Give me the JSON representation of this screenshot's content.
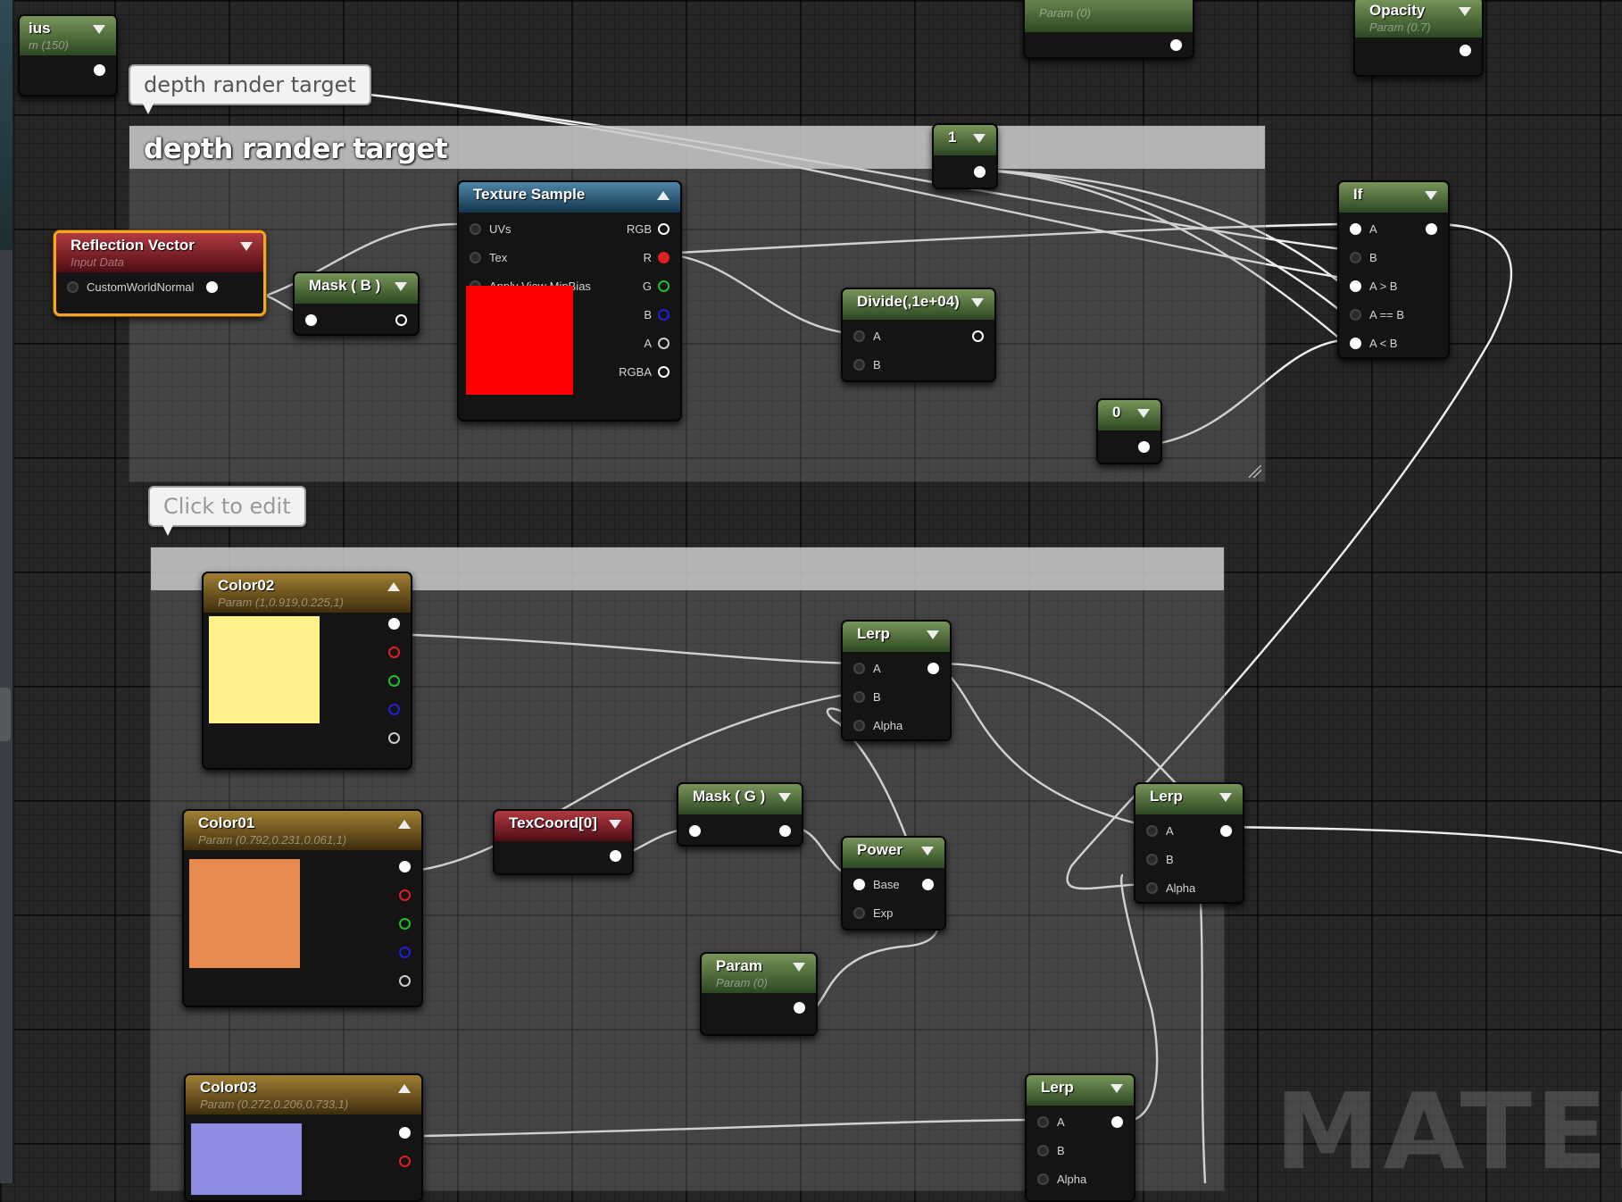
{
  "comments": {
    "top": {
      "bubble": "depth rander target",
      "title": "depth rander target"
    },
    "bottom": {
      "bubble": "Click to edit",
      "title": ""
    }
  },
  "nodes": {
    "radius": {
      "title": "ius",
      "subtitle": "m (150)"
    },
    "param_top": {
      "subtitle": "Param (0)"
    },
    "opacity": {
      "title": "Opacity",
      "subtitle": "Param (0.7)"
    },
    "reflection": {
      "title": "Reflection Vector",
      "subtitle": "Input Data",
      "pin": "CustomWorldNormal"
    },
    "mask_b": {
      "title": "Mask ( B )"
    },
    "texture": {
      "title": "Texture Sample",
      "inputs": [
        "UVs",
        "Tex",
        "Apply View MipBias"
      ],
      "outputs": [
        "RGB",
        "R",
        "G",
        "B",
        "A",
        "RGBA"
      ],
      "swatch_color": "#ff0000"
    },
    "const_one": {
      "title": "1"
    },
    "divide": {
      "title": "Divide(,1e+04)",
      "inputs": [
        "A",
        "B"
      ]
    },
    "const_zero": {
      "title": "0"
    },
    "if": {
      "title": "If",
      "inputs": [
        "A",
        "B",
        "A > B",
        "A == B",
        "A < B"
      ]
    },
    "color02": {
      "title": "Color02",
      "subtitle": "Param (1,0.919,0.225,1)",
      "swatch_color": "#fff28a"
    },
    "color01": {
      "title": "Color01",
      "subtitle": "Param (0.792,0.231,0.061,1)",
      "swatch_color": "#e68a4f"
    },
    "color03": {
      "title": "Color03",
      "subtitle": "Param (0.272,0.206,0.733,1)",
      "swatch_color": "#8c8ce0"
    },
    "texcoord": {
      "title": "TexCoord[0]"
    },
    "mask_g": {
      "title": "Mask ( G )"
    },
    "lerp1": {
      "title": "Lerp",
      "inputs": [
        "A",
        "B",
        "Alpha"
      ]
    },
    "power": {
      "title": "Power",
      "inputs": [
        "Base",
        "Exp"
      ]
    },
    "param": {
      "title": "Param",
      "subtitle": "Param (0)"
    },
    "lerp2": {
      "title": "Lerp",
      "inputs": [
        "A",
        "B",
        "Alpha"
      ]
    },
    "lerp3": {
      "title": "Lerp",
      "inputs": [
        "A",
        "B",
        "Alpha"
      ]
    }
  },
  "watermark": "MATERIA"
}
